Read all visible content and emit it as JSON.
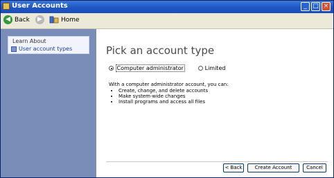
{
  "window": {
    "title": "User Accounts",
    "controls": {
      "minimize": "_",
      "maximize": "□",
      "close": "×"
    }
  },
  "toolbar": {
    "back_label": "Back",
    "home_label": "Home"
  },
  "sidebar": {
    "learn_about_title": "Learn About",
    "items": [
      {
        "label": "User account types"
      }
    ]
  },
  "main": {
    "heading": "Pick an account type",
    "options": [
      {
        "label": "Computer administrator",
        "selected": true
      },
      {
        "label": "Limited",
        "selected": false
      }
    ],
    "description_intro": "With a computer administrator account, you can:",
    "bullets": [
      "Create, change, and delete accounts",
      "Make system-wide changes",
      "Install programs and access all files"
    ]
  },
  "buttons": {
    "back": "< Back",
    "create": "Create Account",
    "cancel": "Cancel"
  },
  "colors": {
    "titlebar": "#1f56c4",
    "sidebar": "#7a8db8",
    "back_arrow": "#2f9a37",
    "close_button": "#d4502f"
  }
}
